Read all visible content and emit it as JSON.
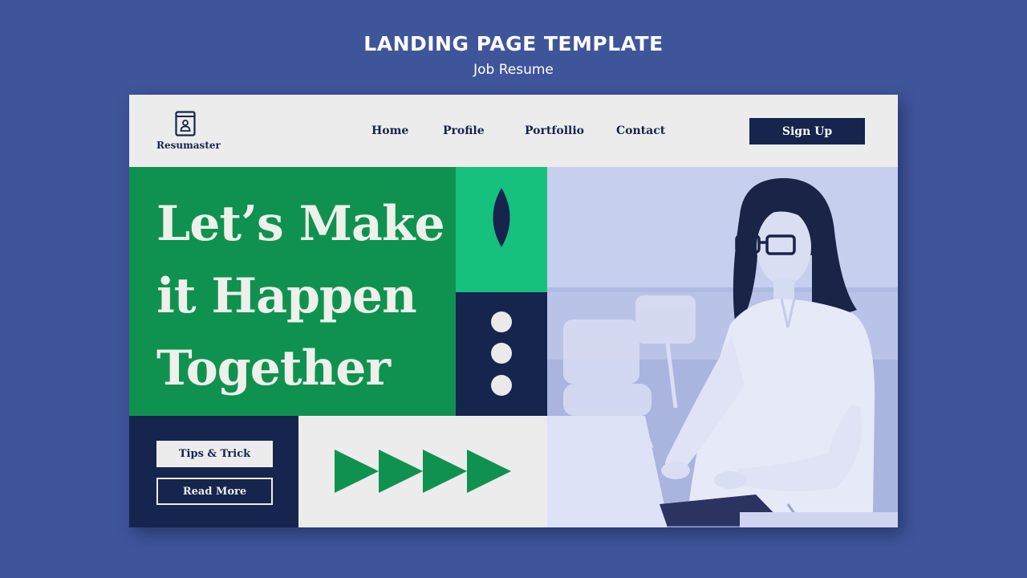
{
  "page": {
    "title": "LANDING PAGE TEMPLATE",
    "subtitle": "Job Resume"
  },
  "nav": {
    "logo_text": "Resumaster",
    "links": [
      "Home",
      "Profile",
      "Portfollio",
      "Contact"
    ],
    "signup_label": "Sign Up"
  },
  "hero": {
    "headline": [
      "Let’s Make",
      "it Happen",
      "Together"
    ]
  },
  "buttons": {
    "tips_label": "Tips & Trick",
    "read_more_label": "Read More"
  },
  "colors": {
    "background": "#3f559a",
    "green": "#0f9250",
    "lime": "#15c17d",
    "navy": "#15254d",
    "light": "#ececec"
  }
}
